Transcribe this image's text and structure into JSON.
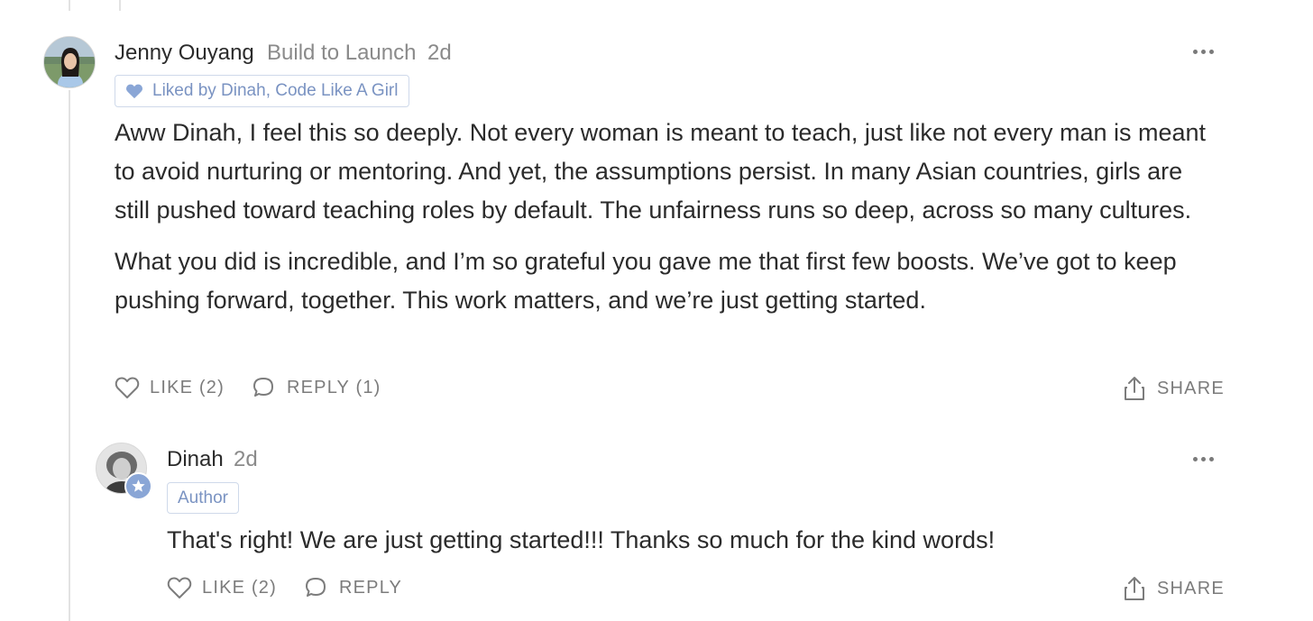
{
  "comment": {
    "author": "Jenny Ouyang",
    "publication": "Build to Launch",
    "time": "2d",
    "liked_by": "Liked by Dinah, Code Like A Girl",
    "paragraphs": [
      "Aww Dinah, I feel this so deeply. Not every woman is meant to teach, just like not every man is meant to avoid nurturing or mentoring. And yet, the assumptions persist. In many Asian countries, girls are still pushed toward teaching roles by default. The unfairness runs so deep, across so many cultures.",
      "What you did is incredible, and I’m so grateful you gave me that first few boosts. We’ve got to keep pushing forward, together. This work matters, and we’re just getting started."
    ],
    "like_label": "LIKE (2)",
    "reply_label": "REPLY (1)",
    "share_label": "SHARE"
  },
  "reply": {
    "author": "Dinah",
    "time": "2d",
    "badge": "Author",
    "text": "That's right! We are just getting started!!! Thanks so much for the kind words!",
    "like_label": "LIKE (2)",
    "reply_label": "REPLY",
    "share_label": "SHARE"
  },
  "icons": {
    "more": "more-dots-icon",
    "like": "heart-icon",
    "reply": "speech-bubble-icon",
    "share": "share-icon",
    "liked": "filled-heart-icon",
    "author_star": "star-icon"
  },
  "colors": {
    "accent": "#7a93c2",
    "accent_fill": "#8aa6d6",
    "muted_text": "#8a8a8a",
    "action_text": "#7c7c7c",
    "thread_line": "#e2e2e2"
  }
}
